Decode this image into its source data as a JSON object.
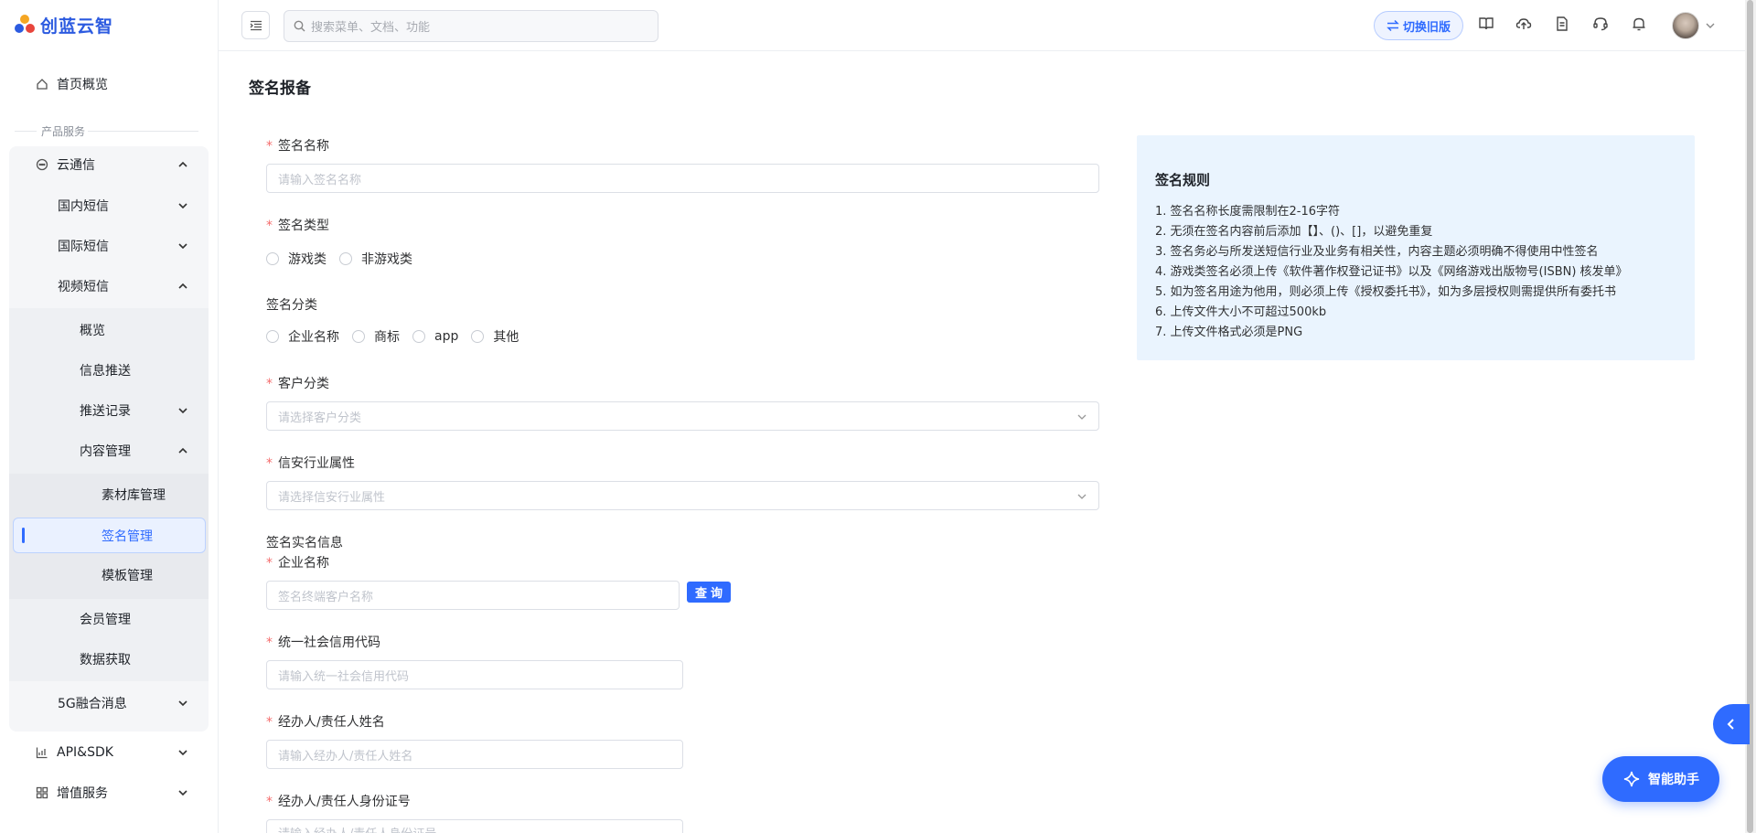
{
  "brand": {
    "name": "创蓝云智"
  },
  "sidebar": {
    "home": "首页概览",
    "section_label": "产品服务",
    "cloud_comm": "云通信",
    "domestic_sms": "国内短信",
    "intl_sms": "国际短信",
    "video_sms": "视频短信",
    "overview": "概览",
    "push": "信息推送",
    "push_records": "推送记录",
    "content_mgmt": "内容管理",
    "material_mgmt": "素材库管理",
    "signature_mgmt": "签名管理",
    "template_mgmt": "模板管理",
    "member_mgmt": "会员管理",
    "data_fetch": "数据获取",
    "fiveg": "5G融合消息",
    "api_sdk": "API&SDK",
    "value_added": "增值服务"
  },
  "topbar": {
    "search_placeholder": "搜索菜单、文档、功能",
    "switch_label": "切换旧版"
  },
  "page": {
    "title": "签名报备"
  },
  "form": {
    "sig_name_label": "签名名称",
    "sig_name_placeholder": "请输入签名名称",
    "sig_type_label": "签名类型",
    "sig_type_options": [
      "游戏类",
      "非游戏类"
    ],
    "sig_cat_label": "签名分类",
    "sig_cat_options": [
      "企业名称",
      "商标",
      "app",
      "其他"
    ],
    "customer_cat_label": "客户分类",
    "customer_cat_placeholder": "请选择客户分类",
    "industry_label": "信安行业属性",
    "industry_placeholder": "请选择信安行业属性",
    "realname_title": "签名实名信息",
    "company_label": "企业名称",
    "company_placeholder": "签名终端客户名称",
    "query_btn": "查询",
    "credit_label": "统一社会信用代码",
    "credit_placeholder": "请输入统一社会信用代码",
    "agent_name_label": "经办人/责任人姓名",
    "agent_name_placeholder": "请输入经办人/责任人姓名",
    "agent_id_label": "经办人/责任人身份证号",
    "agent_id_placeholder": "请输入经办人/责任人身份证号"
  },
  "rules": {
    "title": "签名规则",
    "items": [
      "1. 签名名称长度需限制在2-16字符",
      "2. 无须在签名内容前后添加【】、()、[]，以避免重复",
      "3. 签名务必与所发送短信行业及业务有相关性，内容主题必须明确不得使用中性签名",
      "4. 游戏类签名必须上传《软件著作权登记证书》以及《网络游戏出版物号(ISBN) 核发单》",
      "5. 如为签名用途为他用，则必须上传《授权委托书》，如为多层授权则需提供所有委托书",
      "6. 上传文件大小不可超过500kb",
      "7. 上传文件格式必须是PNG"
    ]
  },
  "assistant": {
    "label": "智能助手"
  },
  "colors": {
    "accent": "#2f6bff",
    "required": "#f56c6c",
    "rules_bg": "#eaf4fe"
  }
}
